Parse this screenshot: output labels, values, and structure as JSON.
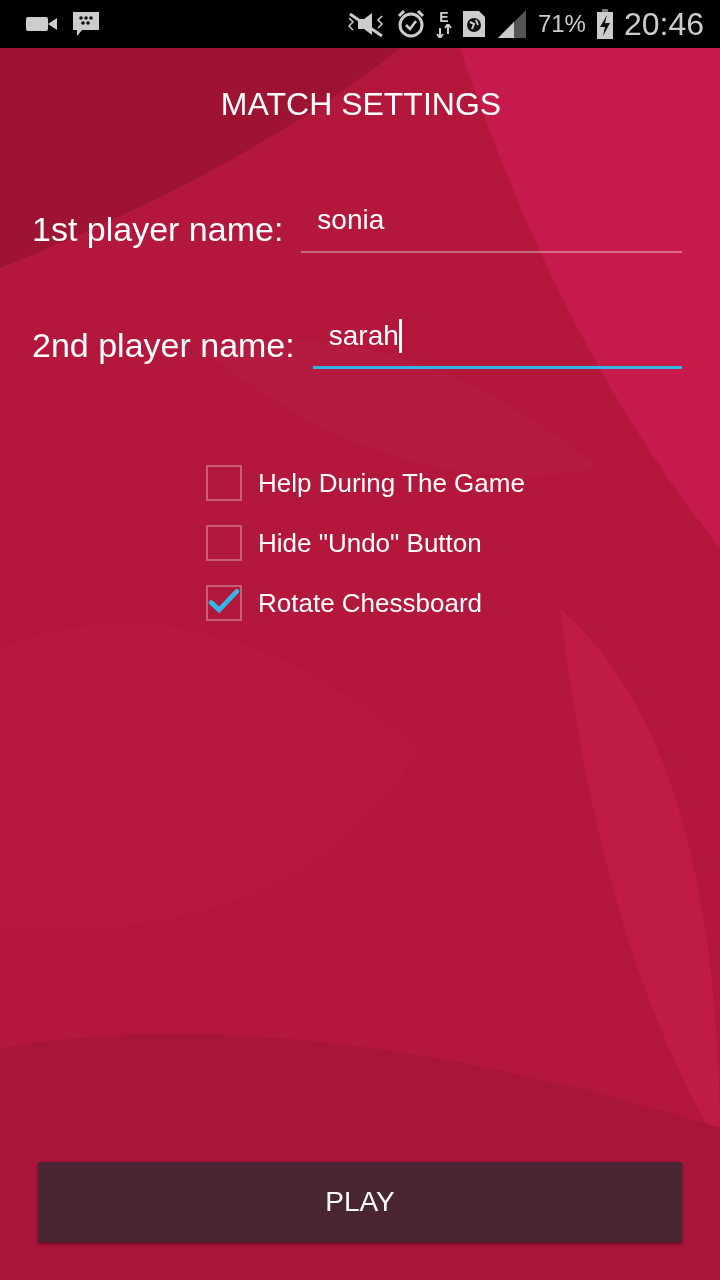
{
  "status_bar": {
    "network_type": "E",
    "battery": "71%",
    "time": "20:46"
  },
  "title": "MATCH SETTINGS",
  "fields": [
    {
      "label": "1st player name:",
      "value": "sonia",
      "focused": false
    },
    {
      "label": "2nd player name:",
      "value": "sarah",
      "focused": true
    }
  ],
  "options": [
    {
      "label": "Help During The Game",
      "checked": false
    },
    {
      "label": "Hide \"Undo\" Button",
      "checked": false
    },
    {
      "label": "Rotate Chessboard",
      "checked": true
    }
  ],
  "play_button": "PLAY"
}
